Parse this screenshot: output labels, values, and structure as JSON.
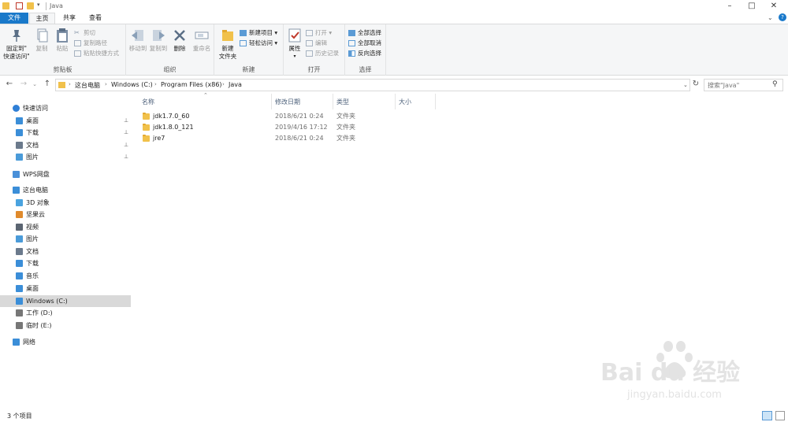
{
  "window": {
    "title": "Java",
    "controls": {
      "minimize": "–",
      "maximize": "□",
      "close": "✕"
    }
  },
  "tabs": [
    {
      "label": "文件"
    },
    {
      "label": "主页"
    },
    {
      "label": "共享"
    },
    {
      "label": "查看"
    }
  ],
  "ribbon": {
    "clipboard": {
      "label": "剪贴板",
      "pin": "固定到\"\n快速访问\"",
      "pin_line1": "固定到\"",
      "pin_line2": "快速访问\"",
      "copy": "复制",
      "paste": "粘贴",
      "cut": "剪切",
      "copy_path": "复制路径",
      "paste_shortcut": "粘贴快捷方式"
    },
    "organize": {
      "label": "组织",
      "move_to": "移动到",
      "copy_to": "复制到",
      "delete": "删除",
      "rename": "重命名"
    },
    "new": {
      "label": "新建",
      "new_folder_line1": "新建",
      "new_folder_line2": "文件夹",
      "new_item": "新建项目 ▾",
      "easy_access": "轻松访问 ▾"
    },
    "open": {
      "label": "打开",
      "properties": "属性",
      "open": "打开 ▾",
      "edit": "编辑",
      "history": "历史记录"
    },
    "select": {
      "label": "选择",
      "select_all": "全部选择",
      "select_none": "全部取消",
      "invert": "反向选择"
    }
  },
  "address": {
    "crumbs": [
      "这台电脑",
      "Windows (C:)",
      "Program Files (x86)",
      "Java"
    ],
    "search_placeholder": "搜索\"Java\""
  },
  "sidebar": {
    "items": [
      {
        "label": "快速访问",
        "icon": "star-icon",
        "color": "#2f7fd6"
      },
      {
        "label": "桌面",
        "icon": "desktop-icon",
        "color": "#3b8ed8",
        "pinned": true
      },
      {
        "label": "下载",
        "icon": "download-icon",
        "color": "#3b8ed8",
        "pinned": true
      },
      {
        "label": "文档",
        "icon": "document-icon",
        "color": "#6b7a8c",
        "pinned": true
      },
      {
        "label": "图片",
        "icon": "picture-icon",
        "color": "#4a9bd9",
        "pinned": true
      },
      {
        "label": "WPS网盘",
        "icon": "cloud-icon",
        "color": "#4a90d9"
      },
      {
        "label": "这台电脑",
        "icon": "computer-icon",
        "color": "#3b8ed8"
      },
      {
        "label": "3D 对象",
        "icon": "cube-icon",
        "color": "#4aa3df"
      },
      {
        "label": "坚果云",
        "icon": "nut-cloud-icon",
        "color": "#e08a2c"
      },
      {
        "label": "视频",
        "icon": "video-icon",
        "color": "#5b6572"
      },
      {
        "label": "图片",
        "icon": "picture-icon",
        "color": "#4a9bd9"
      },
      {
        "label": "文档",
        "icon": "document-icon",
        "color": "#6b7a8c"
      },
      {
        "label": "下载",
        "icon": "download-icon",
        "color": "#3b8ed8"
      },
      {
        "label": "音乐",
        "icon": "music-icon",
        "color": "#3b8ed8"
      },
      {
        "label": "桌面",
        "icon": "desktop-icon",
        "color": "#3b8ed8"
      },
      {
        "label": "Windows (C:)",
        "icon": "drive-windows-icon",
        "color": "#3b8ed8",
        "selected": true
      },
      {
        "label": "工作 (D:)",
        "icon": "drive-icon",
        "color": "#777777"
      },
      {
        "label": "临时 (E:)",
        "icon": "drive-icon",
        "color": "#777777"
      },
      {
        "label": "网络",
        "icon": "network-icon",
        "color": "#3b8ed8"
      }
    ],
    "pin_glyph": "📌"
  },
  "filelist": {
    "columns": [
      "名称",
      "修改日期",
      "类型",
      "大小"
    ],
    "rows": [
      {
        "name": "jdk1.7.0_60",
        "date": "2018/6/21 0:24",
        "type": "文件夹",
        "size": ""
      },
      {
        "name": "jdk1.8.0_121",
        "date": "2019/4/16 17:12",
        "type": "文件夹",
        "size": ""
      },
      {
        "name": "jre7",
        "date": "2018/6/21 0:24",
        "type": "文件夹",
        "size": ""
      }
    ]
  },
  "status": {
    "count": "3 个项目"
  },
  "watermark": {
    "brand": "Bai du 经验",
    "url": "jingyan.baidu.com"
  },
  "colors": {
    "accent": "#1979ca",
    "folder": "#f1c14b",
    "selection": "#d9d9d9"
  }
}
